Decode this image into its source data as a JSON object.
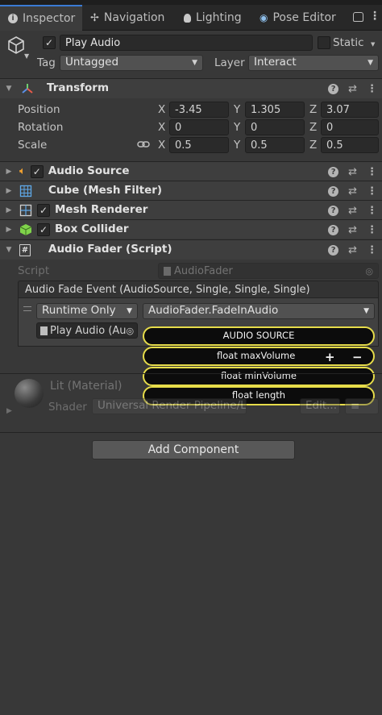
{
  "tabs": [
    {
      "label": "Inspector",
      "icon": "info-icon"
    },
    {
      "label": "Navigation",
      "icon": "navigation-icon"
    },
    {
      "label": "Lighting",
      "icon": "lightbulb-icon"
    },
    {
      "label": "Pose Editor",
      "icon": "eye-icon"
    }
  ],
  "header": {
    "object_name": "Play Audio",
    "static_label": "Static",
    "tag_label": "Tag",
    "tag_value": "Untagged",
    "layer_label": "Layer",
    "layer_value": "Interact"
  },
  "transform": {
    "title": "Transform",
    "position_label": "Position",
    "rotation_label": "Rotation",
    "scale_label": "Scale",
    "position": {
      "x": "-3.45",
      "y": "1.305",
      "z": "3.07"
    },
    "rotation": {
      "x": "0",
      "y": "0",
      "z": "0"
    },
    "scale": {
      "x": "0.5",
      "y": "0.5",
      "z": "0.5"
    },
    "axis_x": "X",
    "axis_y": "Y",
    "axis_z": "Z"
  },
  "components": [
    {
      "title": "Audio Source",
      "icon": "speaker-icon",
      "checked": true
    },
    {
      "title": "Cube (Mesh Filter)",
      "icon": "mesh-filter-icon",
      "checked": false
    },
    {
      "title": "Mesh Renderer",
      "icon": "mesh-renderer-icon",
      "checked": true
    },
    {
      "title": "Box Collider",
      "icon": "box-collider-icon",
      "checked": true
    }
  ],
  "audio_fader": {
    "title": "Audio Fader (Script)",
    "script_label": "Script",
    "script_value": "AudioFader",
    "event_title": "Audio Fade Event (AudioSource, Single, Single, Single)",
    "runtime_value": "Runtime Only",
    "function_value": "AudioFader.FadeInAudio",
    "object_value": "Play Audio (Au"
  },
  "annotations": {
    "audio_source": "AUDIO SOURCE",
    "max_volume": "float maxVolume",
    "min_volume": "float minVolume",
    "length": "float length",
    "plus": "+",
    "minus": "−"
  },
  "material": {
    "name": "Lit (Material)",
    "shader_label": "Shader",
    "shader_value": "Universal Render Pipeline/Lit",
    "edit_label": "Edit..."
  },
  "add_component_label": "Add Component",
  "colors": {
    "background": "#383838",
    "accent": "#3a7bd5",
    "highlight": "#e6dc4a"
  }
}
